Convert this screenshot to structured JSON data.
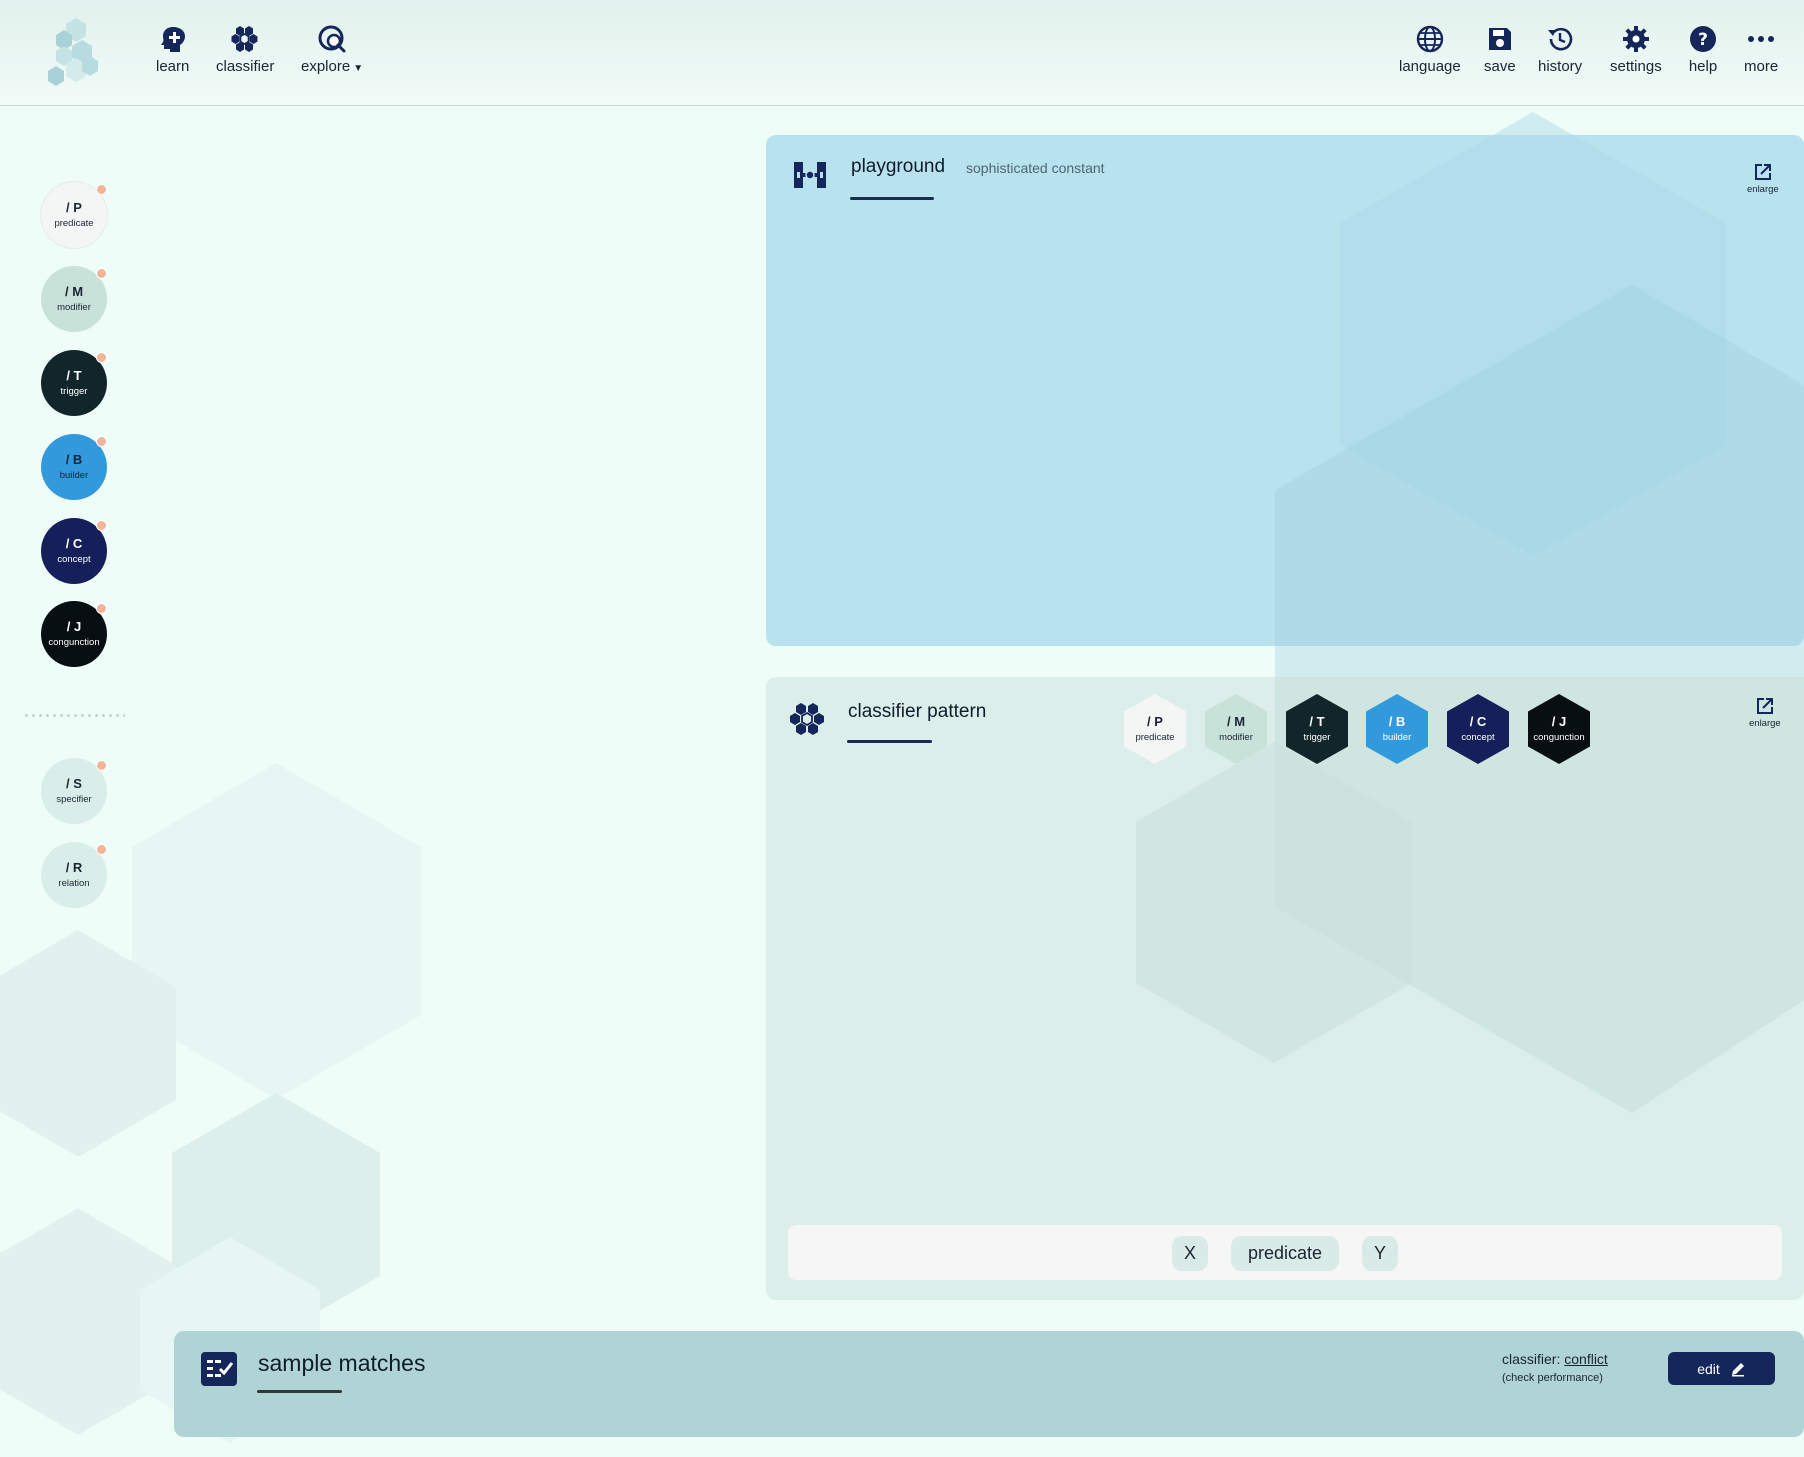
{
  "nav_left": [
    {
      "label": "learn",
      "icon": "brain-plus-icon"
    },
    {
      "label": "classifier",
      "icon": "hexagon-cluster-icon"
    },
    {
      "label": "explore",
      "icon": "globe-search-icon",
      "has_dropdown": true
    }
  ],
  "nav_right": [
    {
      "label": "language",
      "icon": "globe-icon"
    },
    {
      "label": "save",
      "icon": "floppy-disk-icon"
    },
    {
      "label": "history",
      "icon": "history-clock-icon"
    },
    {
      "label": "settings",
      "icon": "gear-icon"
    },
    {
      "label": "help",
      "icon": "question-circle-icon"
    },
    {
      "label": "more",
      "icon": "ellipsis-icon"
    }
  ],
  "sidebar": {
    "primary": [
      {
        "code": "/ P",
        "name": "predicate",
        "bg": "#f4f6f5",
        "fg": "#1a2433"
      },
      {
        "code": "/ M",
        "name": "modifier",
        "bg": "#c8e2da",
        "fg": "#1a2433"
      },
      {
        "code": "/ T",
        "name": "trigger",
        "bg": "#10262a",
        "fg": "#ffffff"
      },
      {
        "code": "/ B",
        "name": "builder",
        "bg": "#3299dd",
        "fg": "#10243a"
      },
      {
        "code": "/ C",
        "name": "concept",
        "bg": "#15205a",
        "fg": "#ffffff"
      },
      {
        "code": "/ J",
        "name": "conguncti​on",
        "bg": "#070f12",
        "fg": "#ffffff"
      }
    ],
    "secondary": [
      {
        "code": "/ S",
        "name": "specifier",
        "bg": "#d9eee9",
        "fg": "#1a2433"
      },
      {
        "code": "/ R",
        "name": "relation",
        "bg": "#d9eee9",
        "fg": "#1a2433"
      }
    ]
  },
  "playground": {
    "title": "playground",
    "subtitle": "sophisticated constant",
    "enlarge_label": "enlarge"
  },
  "classifier_pattern": {
    "title": "classifier pattern",
    "enlarge_label": "enlarge",
    "hexes": [
      {
        "code": "/ P",
        "name": "predicate",
        "bg": "#f4f6f5",
        "fg": "#1a2433"
      },
      {
        "code": "/ M",
        "name": "modifier",
        "bg": "#c8e2da",
        "fg": "#1a2433"
      },
      {
        "code": "/ T",
        "name": "trigger",
        "bg": "#10262a",
        "fg": "#ffffff"
      },
      {
        "code": "/ B",
        "name": "builder",
        "bg": "#3299dd",
        "fg": "#ffffff"
      },
      {
        "code": "/ C",
        "name": "concept",
        "bg": "#15205a",
        "fg": "#ffffff"
      },
      {
        "code": "/ J",
        "name": "conguncti​on",
        "bg": "#070f12",
        "fg": "#ffffff"
      }
    ],
    "pattern_tokens": [
      "X",
      "predicate",
      "Y"
    ]
  },
  "sample_matches": {
    "title": "sample matches",
    "classifier_label": "classifier:",
    "classifier_name": "conflict",
    "check_performance": "(check performance)",
    "edit_label": "edit"
  },
  "colors": {
    "accent": "#15265a",
    "playground_bg": "#b9e2ef",
    "classifier_bg": "#dbeee9",
    "matches_bg": "#b0d3d6",
    "page_bg": "#effdf8"
  }
}
